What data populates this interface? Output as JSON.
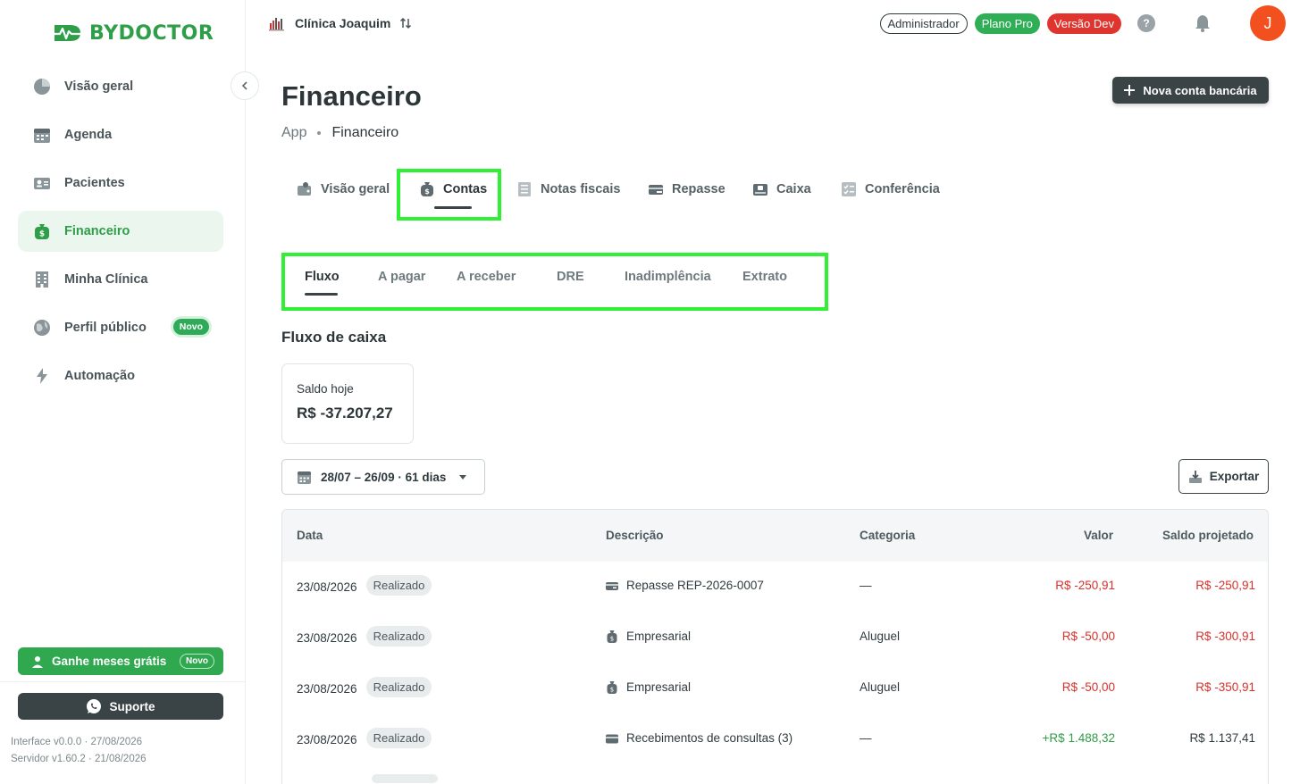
{
  "app": {
    "brand": "BYDOCTOR",
    "accent": "#2e9e48"
  },
  "sidebar": {
    "items": [
      {
        "label": "Visão geral",
        "icon": "pie-chart-icon"
      },
      {
        "label": "Agenda",
        "icon": "calendar-icon"
      },
      {
        "label": "Pacientes",
        "icon": "id-card-icon"
      },
      {
        "label": "Financeiro",
        "icon": "money-bag-icon",
        "active": true
      },
      {
        "label": "Minha Clínica",
        "icon": "building-icon"
      },
      {
        "label": "Perfil público",
        "icon": "globe-icon",
        "badge": "Novo"
      },
      {
        "label": "Automação",
        "icon": "bolt-icon"
      }
    ],
    "promo_label": "Ganhe meses grátis",
    "promo_badge": "Novo",
    "support_label": "Suporte",
    "interface_version": "Interface v0.0.0 · 27/08/2026",
    "server_version": "Servidor v1.60.2 · 21/08/2026"
  },
  "topbar": {
    "clinic_name": "Clínica Joaquim",
    "role_badge": "Administrador",
    "plan_badge": "Plano Pro",
    "version_badge": "Versão Dev",
    "help_label": "?",
    "avatar_initial": "J"
  },
  "page": {
    "title": "Financeiro",
    "breadcrumb": [
      "App",
      "Financeiro"
    ],
    "new_account_label": "Nova conta bancária"
  },
  "main_tabs": [
    {
      "label": "Visão geral",
      "icon": "pie-chart-icon"
    },
    {
      "label": "Contas",
      "icon": "money-bag-icon",
      "active": true
    },
    {
      "label": "Notas fiscais",
      "icon": "receipt-icon"
    },
    {
      "label": "Repasse",
      "icon": "transfer-icon"
    },
    {
      "label": "Caixa",
      "icon": "cash-register-icon"
    },
    {
      "label": "Conferência",
      "icon": "checklist-icon"
    }
  ],
  "sub_tabs": [
    {
      "label": "Fluxo",
      "active": true
    },
    {
      "label": "A pagar"
    },
    {
      "label": "A receber"
    },
    {
      "label": "DRE"
    },
    {
      "label": "Inadimplência"
    },
    {
      "label": "Extrato"
    }
  ],
  "cashflow": {
    "section_title": "Fluxo de caixa",
    "balance_label": "Saldo hoje",
    "balance_value": "R$ -37.207,27",
    "date_range": "28/07 – 26/09 · 61 dias",
    "export_label": "Exportar"
  },
  "table": {
    "columns": [
      "Data",
      "Descrição",
      "Categoria",
      "Valor",
      "Saldo projetado"
    ],
    "rows": [
      {
        "date": "23/08/2026",
        "status": "Realizado",
        "description": "Repasse REP-2026-0007",
        "icon": "transfer-icon",
        "category": "—",
        "value": "R$ -250,91",
        "balance": "R$ -250,91"
      },
      {
        "date": "23/08/2026",
        "status": "Realizado",
        "description": "Empresarial",
        "icon": "money-bag-icon",
        "category": "Aluguel",
        "value": "R$ -50,00",
        "balance": "R$ -300,91"
      },
      {
        "date": "23/08/2026",
        "status": "Realizado",
        "description": "Empresarial",
        "icon": "money-bag-icon",
        "category": "Aluguel",
        "value": "R$ -50,00",
        "balance": "R$ -350,91"
      },
      {
        "date": "23/08/2026",
        "status": "Realizado",
        "description": "Recebimentos de consultas (3)",
        "icon": "card-icon",
        "category": "—",
        "value": "+R$ 1.488,32",
        "balance": "R$ 1.137,41"
      },
      {
        "date": "",
        "status": "",
        "description": "",
        "icon": "",
        "category": "",
        "value": "",
        "balance": ""
      }
    ]
  },
  "colors": {
    "negative": "#d6312b",
    "positive": "#2e9e48",
    "highlight": "#31ef34"
  }
}
